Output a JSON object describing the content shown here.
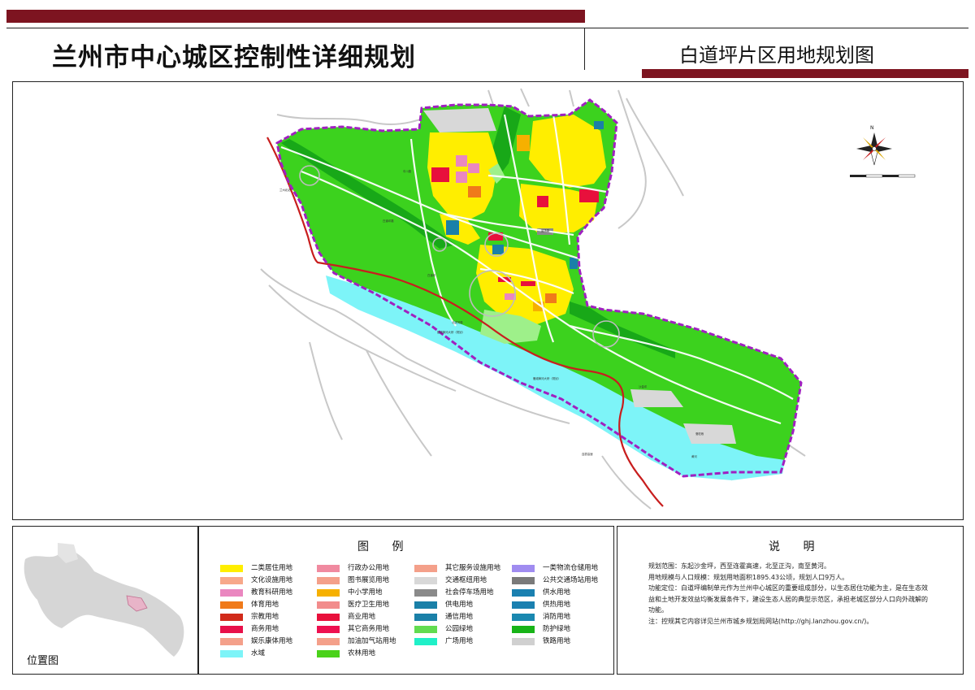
{
  "header": {
    "title": "兰州市中心城区控制性详细规划",
    "subtitle": "白道坪片区用地规划图"
  },
  "colors": {
    "brand_bar": "#7d1420",
    "boundary": "#a020c0",
    "railway": "#c81e1e"
  },
  "map": {
    "compass_label": "N",
    "labels": [
      "兰州北站",
      "中川路",
      "白道坪路",
      "沙金坪",
      "盐场路",
      "北滨河路",
      "白道坪",
      "骆驼巷",
      "黄河",
      "银滩黄河大桥（规划）",
      "雁滩黄河大桥（规划）",
      "连霍高速"
    ]
  },
  "legend": {
    "title": "图  例",
    "items": [
      {
        "label": "二类居住用地",
        "color": "#ffee00"
      },
      {
        "label": "文化设施用地",
        "color": "#f7a88a"
      },
      {
        "label": "教育科研用地",
        "color": "#ea87c0"
      },
      {
        "label": "体育用地",
        "color": "#f07a1a"
      },
      {
        "label": "宗教用地",
        "color": "#d12a1a"
      },
      {
        "label": "商务用地",
        "color": "#e8104a"
      },
      {
        "label": "娱乐康体用地",
        "color": "#f4a08a"
      },
      {
        "label": "水域",
        "color": "#7df4f8"
      },
      {
        "label": "行政办公用地",
        "color": "#f08aa0"
      },
      {
        "label": "图书展览用地",
        "color": "#f4a08a"
      },
      {
        "label": "中小学用地",
        "color": "#f6b000"
      },
      {
        "label": "医疗卫生用地",
        "color": "#f28c8c"
      },
      {
        "label": "商业用地",
        "color": "#e8103c"
      },
      {
        "label": "其它商务用地",
        "color": "#ee1050"
      },
      {
        "label": "加油加气站用地",
        "color": "#f4a08a"
      },
      {
        "label": "农林用地",
        "color": "#4ad21a"
      },
      {
        "label": "其它服务设施用地",
        "color": "#f4a08a"
      },
      {
        "label": "交通枢纽用地",
        "color": "#d8d8d8"
      },
      {
        "label": "社会停车场用地",
        "color": "#8a8a8a"
      },
      {
        "label": "供电用地",
        "color": "#1a80a8"
      },
      {
        "label": "通信用地",
        "color": "#1a80a8"
      },
      {
        "label": "公园绿地",
        "color": "#62dc50"
      },
      {
        "label": "广场用地",
        "color": "#20f0c8"
      },
      {
        "label": "一类物流仓储用地",
        "color": "#a08cf0"
      },
      {
        "label": "公共交通场站用地",
        "color": "#7a7a7a"
      },
      {
        "label": "供水用地",
        "color": "#1a80b0"
      },
      {
        "label": "供热用地",
        "color": "#1a80b0"
      },
      {
        "label": "消防用地",
        "color": "#1a88b0"
      },
      {
        "label": "防护绿地",
        "color": "#18b418"
      },
      {
        "label": "铁路用地",
        "color": "#d0d0d0"
      }
    ]
  },
  "notes": {
    "title": "说  明",
    "lines": [
      "规划范围：东起沙金坪，西至连霍高速，北至正沟，南至黄河。",
      "用地规模与人口规模：规划用地面积1895.43公顷，规划人口9万人。",
      "功能定位：白道坪编制单元作为兰州中心城区的重要组成部分，以生态居住功能为主，是在生态效",
      "益和土地开发效益均衡发展条件下，建设生态人居的典型示范区，承担老城区部分人口向外疏解的",
      "功能。",
      "注：控规其它内容详见兰州市城乡规划局网站(http://ghj.lanzhou.gov.cn/)。"
    ]
  },
  "location": {
    "label": "位置图"
  }
}
